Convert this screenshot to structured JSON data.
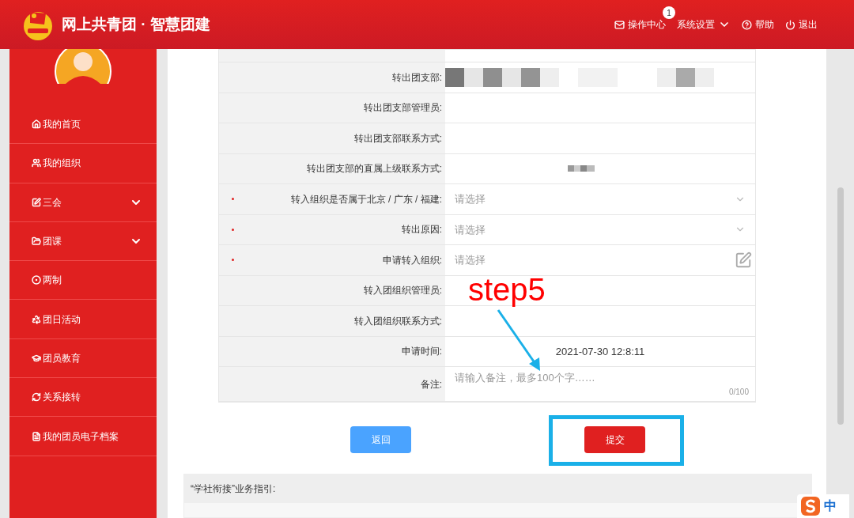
{
  "header": {
    "title": "网上共青团 · 智慧团建",
    "nav": [
      {
        "label": "操作中心",
        "badge": "1"
      },
      {
        "label": "系统设置"
      },
      {
        "label": "帮助"
      },
      {
        "label": "退出"
      }
    ]
  },
  "sidebar": {
    "items": [
      {
        "label": "我的首页",
        "expandable": false
      },
      {
        "label": "我的组织",
        "expandable": false
      },
      {
        "label": "三会",
        "expandable": true
      },
      {
        "label": "团课",
        "expandable": true
      },
      {
        "label": "两制",
        "expandable": false
      },
      {
        "label": "团日活动",
        "expandable": false
      },
      {
        "label": "团员教育",
        "expandable": false
      },
      {
        "label": "关系接转",
        "expandable": false
      },
      {
        "label": "我的团员电子档案",
        "expandable": false
      }
    ]
  },
  "form": {
    "rows": [
      {
        "label": "转出团支部:",
        "required": false,
        "kind": "redacted"
      },
      {
        "label": "转出团支部管理员:",
        "required": false,
        "kind": "empty"
      },
      {
        "label": "转出团支部联系方式:",
        "required": false,
        "kind": "empty"
      },
      {
        "label": "转出团支部的直属上级联系方式:",
        "required": false,
        "kind": "redacted_small"
      },
      {
        "label": "转入组织是否属于北京 / 广东 / 福建:",
        "required": true,
        "kind": "select",
        "placeholder": "请选择"
      },
      {
        "label": "转出原因:",
        "required": true,
        "kind": "select",
        "placeholder": "请选择"
      },
      {
        "label": "申请转入组织:",
        "required": true,
        "kind": "picker",
        "placeholder": "请选择"
      },
      {
        "label": "转入团组织管理员:",
        "required": false,
        "kind": "empty"
      },
      {
        "label": "转入团组织联系方式:",
        "required": false,
        "kind": "empty"
      },
      {
        "label": "申请时间:",
        "required": false,
        "kind": "text",
        "value": "2021-07-30 12:8:11"
      },
      {
        "label": "备注:",
        "required": false,
        "kind": "textarea",
        "placeholder": "请输入备注，最多100个字……",
        "counter": "0/100"
      }
    ]
  },
  "buttons": [
    {
      "label": "返回",
      "kind": "secondary",
      "highlighted": false
    },
    {
      "label": "提交",
      "kind": "primary",
      "highlighted": true
    }
  ],
  "guide": {
    "title": "“学社衔接”业务指引:"
  },
  "annotation": {
    "text": "step5"
  },
  "ime": {
    "label": "中"
  }
}
